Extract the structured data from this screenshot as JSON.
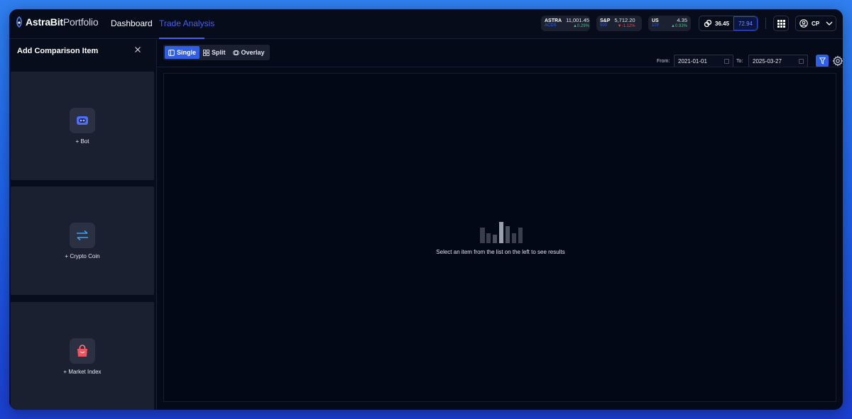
{
  "app": {
    "logo_bold": "AstraBit",
    "logo_thin": "Portfolio"
  },
  "nav": {
    "dashboard": "Dashboard",
    "trade_analysis": "Trade Analysis"
  },
  "tickers": [
    {
      "symbol": "ASTRA",
      "sub": "ACDS",
      "price": "11,001.45",
      "change": "▲0.29%",
      "direction": "up"
    },
    {
      "symbol": "S&P",
      "sub": "500",
      "price": "5,712.20",
      "change": "▼-1.12%",
      "direction": "down"
    },
    {
      "symbol": "US",
      "sub": "10Y",
      "price": "4.35",
      "change": "▲0.93%",
      "direction": "up"
    }
  ],
  "gas": {
    "value1": "36.45",
    "value2": "72.94"
  },
  "user": {
    "initials": "CP"
  },
  "sidebar": {
    "title": "Add Comparison Item",
    "items": [
      {
        "label": "+  Bot",
        "icon": "bot-icon"
      },
      {
        "label": "+  Crypto Coin",
        "icon": "swap-arrows-icon"
      },
      {
        "label": "+  Market Index",
        "icon": "shopping-bag-icon"
      }
    ]
  },
  "toolbar": {
    "modes": [
      {
        "label": "Single",
        "active": true
      },
      {
        "label": "Split",
        "active": false
      },
      {
        "label": "Overlay",
        "active": false
      }
    ],
    "from_label": "From:",
    "from_value": "2021-01-01",
    "to_label": "To:",
    "to_value": "2025-03-27"
  },
  "main": {
    "empty_message": "Select an item from the list on the left to see results"
  },
  "colors": {
    "accent": "#2f5fe8",
    "background": "#050a18",
    "card": "#1b2030",
    "up": "#36c77a",
    "down": "#e84a4a"
  }
}
